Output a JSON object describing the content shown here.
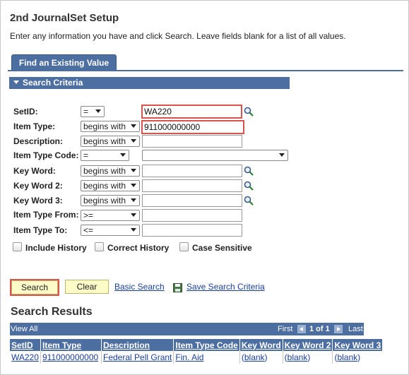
{
  "page": {
    "title": "2nd JournalSet Setup",
    "instructions": "Enter any information you have and click Search. Leave fields blank for a list of all values."
  },
  "tabs": {
    "find_existing": "Find an Existing Value"
  },
  "search_criteria": {
    "header": "Search Criteria",
    "fields": {
      "setid": {
        "label": "SetID:",
        "operator": "=",
        "value": "WA220"
      },
      "item_type": {
        "label": "Item Type:",
        "operator": "begins with",
        "value": "911000000000"
      },
      "description": {
        "label": "Description:",
        "operator": "begins with",
        "value": ""
      },
      "item_type_code": {
        "label": "Item Type Code:",
        "operator": "=",
        "value": ""
      },
      "key_word": {
        "label": "Key Word:",
        "operator": "begins with",
        "value": ""
      },
      "key_word_2": {
        "label": "Key Word 2:",
        "operator": "begins with",
        "value": ""
      },
      "key_word_3": {
        "label": "Key Word 3:",
        "operator": "begins with",
        "value": ""
      },
      "item_type_from": {
        "label": "Item Type From:",
        "operator": ">=",
        "value": ""
      },
      "item_type_to": {
        "label": "Item Type To:",
        "operator": "<=",
        "value": ""
      }
    },
    "checkboxes": {
      "include_history": "Include History",
      "correct_history": "Correct History",
      "case_sensitive": "Case Sensitive"
    }
  },
  "actions": {
    "search": "Search",
    "clear": "Clear",
    "basic_search": "Basic Search",
    "save_search_criteria": "Save Search Criteria"
  },
  "results": {
    "title": "Search Results",
    "view_all": "View All",
    "first": "First",
    "range": "1 of 1",
    "last": "Last",
    "columns": [
      "SetID",
      "Item Type",
      "Description",
      "Item Type Code",
      "Key Word",
      "Key Word 2",
      "Key Word 3"
    ],
    "rows": [
      [
        "WA220",
        "911000000000",
        "Federal Pell Grant",
        "Fin. Aid",
        "(blank)",
        "(blank)",
        "(blank)"
      ]
    ]
  },
  "colors": {
    "header_blue": "#4d6ea0",
    "button_yellow": "#fdfbc8",
    "highlight_red": "#d9534f",
    "link_blue": "#1a3f9c"
  }
}
